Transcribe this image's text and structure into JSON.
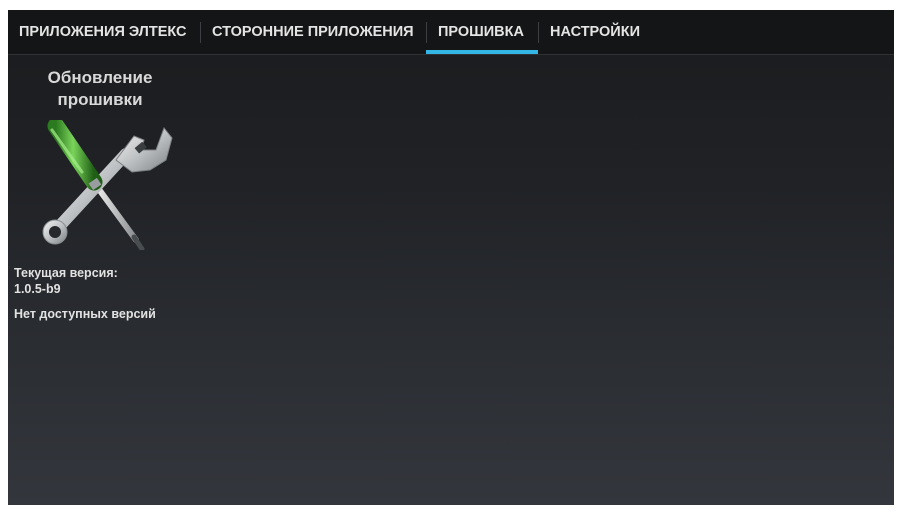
{
  "tabs": [
    {
      "label": "ПРИЛОЖЕНИЯ ЭЛТЕКС",
      "active": false
    },
    {
      "label": "СТОРОННИЕ ПРИЛОЖЕНИЯ",
      "active": false
    },
    {
      "label": "ПРОШИВКА",
      "active": true
    },
    {
      "label": "НАСТРОЙКИ",
      "active": false
    }
  ],
  "accent_color": "#33b5e5",
  "firmware_app": {
    "title_line1": "Обновление",
    "title_line2": "прошивки",
    "icon": "tools-icon"
  },
  "version_info": {
    "current_label": "Текущая версия:",
    "current_value": "1.0.5-b9",
    "status": "Нет доступных версий"
  }
}
